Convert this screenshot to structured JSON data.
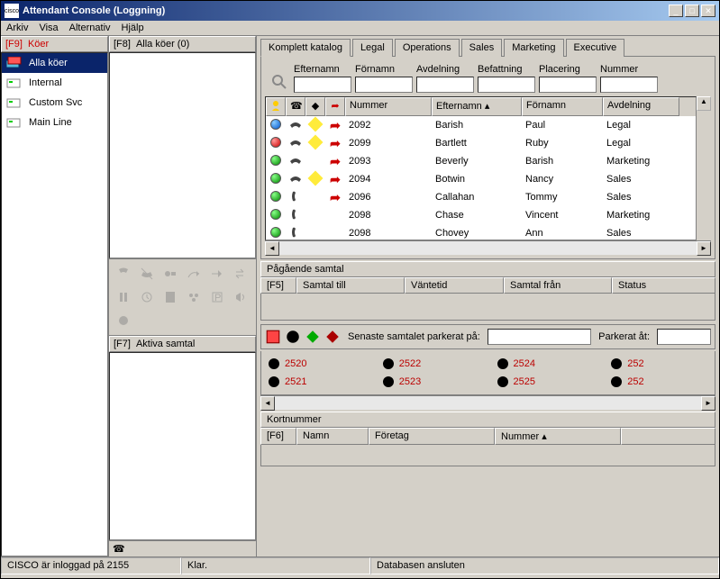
{
  "window": {
    "title": "Attendant Console (Loggning)",
    "icon_text": "cisco"
  },
  "menu": [
    "Arkiv",
    "Visa",
    "Alternativ",
    "Hjälp"
  ],
  "queues_panel": {
    "key": "[F9]",
    "title": "Köer",
    "items": [
      {
        "label": "Alla köer",
        "selected": true
      },
      {
        "label": "Internal",
        "selected": false
      },
      {
        "label": "Custom Svc",
        "selected": false
      },
      {
        "label": "Main Line",
        "selected": false
      }
    ]
  },
  "all_queues_panel": {
    "key": "[F8]",
    "title": "Alla köer (0)"
  },
  "active_calls_panel": {
    "key": "[F7]",
    "title": "Aktiva samtal"
  },
  "directory": {
    "tabs": [
      "Komplett katalog",
      "Legal",
      "Operations",
      "Sales",
      "Marketing",
      "Executive"
    ],
    "filters": [
      {
        "label": "Efternamn"
      },
      {
        "label": "Förnamn"
      },
      {
        "label": "Avdelning"
      },
      {
        "label": "Befattning"
      },
      {
        "label": "Placering"
      },
      {
        "label": "Nummer"
      }
    ],
    "columns": {
      "nummer": "Nummer",
      "efternamn": "Efternamn",
      "fornamn": "Förnamn",
      "avdelning": "Avdelning"
    },
    "rows": [
      {
        "status": "blue",
        "phone": true,
        "note": true,
        "arrow": true,
        "nummer": "2092",
        "efternamn": "Barish",
        "fornamn": "Paul",
        "avdelning": "Legal"
      },
      {
        "status": "red",
        "phone": true,
        "note": true,
        "arrow": true,
        "nummer": "2099",
        "efternamn": "Bartlett",
        "fornamn": "Ruby",
        "avdelning": "Legal"
      },
      {
        "status": "green",
        "phone": true,
        "note": false,
        "arrow": true,
        "nummer": "2093",
        "efternamn": "Beverly",
        "fornamn": "Barish",
        "avdelning": "Marketing"
      },
      {
        "status": "green",
        "phone": true,
        "note": true,
        "arrow": true,
        "nummer": "2094",
        "efternamn": "Botwin",
        "fornamn": "Nancy",
        "avdelning": "Sales"
      },
      {
        "status": "green",
        "phone_hook": true,
        "note": false,
        "arrow": true,
        "nummer": "2096",
        "efternamn": "Callahan",
        "fornamn": "Tommy",
        "avdelning": "Sales"
      },
      {
        "status": "green",
        "phone_hook": true,
        "note": false,
        "arrow": false,
        "nummer": "2098",
        "efternamn": "Chase",
        "fornamn": "Vincent",
        "avdelning": "Marketing"
      },
      {
        "status": "green",
        "phone_hook": true,
        "note": false,
        "arrow": false,
        "nummer": "2098",
        "efternamn": "Chovey",
        "fornamn": "Ann",
        "avdelning": "Sales"
      }
    ]
  },
  "ongoing_calls": {
    "title": "Pågående samtal",
    "key": "[F5]",
    "cols": [
      "Samtal till",
      "Väntetid",
      "Samtal från",
      "Status"
    ]
  },
  "park": {
    "last_label": "Senaste samtalet parkerat på:",
    "parked_for_label": "Parkerat åt:",
    "slots": [
      "2520",
      "2522",
      "2524",
      "252",
      "2521",
      "2523",
      "2525",
      "252"
    ]
  },
  "speed_dial": {
    "title": "Kortnummer",
    "key": "[F6]",
    "cols": [
      "Namn",
      "Företag",
      "Nummer"
    ]
  },
  "statusbar": {
    "login": "CISCO är inloggad på 2155",
    "ready": "Klar.",
    "db": "Databasen ansluten"
  }
}
